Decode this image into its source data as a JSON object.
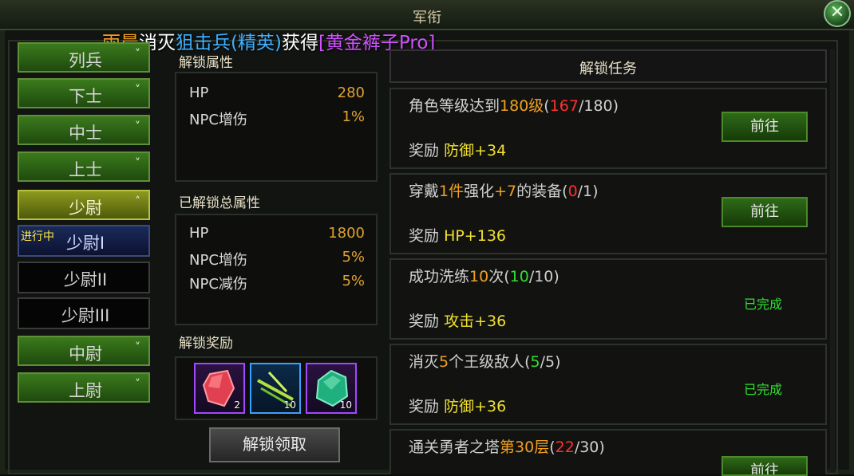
{
  "window": {
    "title": "军衔",
    "close_symbol": "✕"
  },
  "broadcast": {
    "player": "雨晨",
    "verb1": "消灭",
    "enemy": "狙击兵(精英)",
    "verb2": "获得",
    "item": "[黄金裤子Pro]"
  },
  "ranks": [
    {
      "label": "列兵",
      "chev": "˅",
      "style": "green"
    },
    {
      "label": "下士",
      "chev": "˅",
      "style": "green"
    },
    {
      "label": "中士",
      "chev": "˅",
      "style": "green"
    },
    {
      "label": "上士",
      "chev": "˅",
      "style": "green"
    },
    {
      "label": "少尉",
      "chev": "˄",
      "style": "yellow"
    },
    {
      "label": "少尉I",
      "tag": "进行中",
      "style": "active"
    },
    {
      "label": "少尉II",
      "style": "dark"
    },
    {
      "label": "少尉III",
      "style": "dark"
    },
    {
      "label": "中尉",
      "chev": "˅",
      "style": "green"
    },
    {
      "label": "上尉",
      "chev": "˅",
      "style": "green"
    }
  ],
  "unlock_attrs": {
    "title": "解锁属性",
    "rows": [
      {
        "k": "HP",
        "v": "280"
      },
      {
        "k": "NPC增伤",
        "v": "1%"
      }
    ]
  },
  "total_attrs": {
    "title": "已解锁总属性",
    "rows": [
      {
        "k": "HP",
        "v": "1800"
      },
      {
        "k": "NPC增伤",
        "v": "5%"
      },
      {
        "k": "NPC减伤",
        "v": "5%"
      }
    ]
  },
  "rewards": {
    "title": "解锁奖励",
    "items": [
      {
        "icon": "red-crystal-icon",
        "count": "2",
        "rarity": "purple"
      },
      {
        "icon": "green-arrows-icon",
        "count": "10",
        "rarity": "blue"
      },
      {
        "icon": "green-gem-icon",
        "count": "10",
        "rarity": "purple"
      }
    ],
    "button": "解锁领取"
  },
  "tasks": {
    "title": "解锁任务",
    "reward_prefix": "奖励",
    "items": [
      {
        "d1": "角色等级达到",
        "d2": "180级",
        "d3": "(",
        "d4": "167",
        "d5": "/180)",
        "reward": "防御+34",
        "action": "前往",
        "state": "go"
      },
      {
        "d1": "穿戴",
        "d2": "1件",
        "d3": "强化",
        "d4": "+7",
        "d5": "的装备(",
        "d6": "0",
        "d7": "/1)",
        "reward": "HP+136",
        "action": "前往",
        "state": "go"
      },
      {
        "d1": "成功洗练",
        "d2": "10",
        "d3": "次(",
        "d4": "10",
        "d5": "/10)",
        "reward": "攻击+36",
        "action": "已完成",
        "state": "done"
      },
      {
        "d1": "消灭",
        "d2": "5",
        "d3": "个王级敌人(",
        "d4": "5",
        "d5": "/5)",
        "reward": "防御+36",
        "action": "已完成",
        "state": "done"
      },
      {
        "d1": "通关勇者之塔",
        "d2": "第30层",
        "d3": "(",
        "d4": "22",
        "d5": "/30)",
        "action": "前往",
        "state": "go"
      }
    ]
  },
  "colors": {
    "accent_orange": "#f0a020",
    "progress_red": "#ff3030",
    "done_green": "#30e030",
    "reward_yellow": "#f0e030"
  }
}
